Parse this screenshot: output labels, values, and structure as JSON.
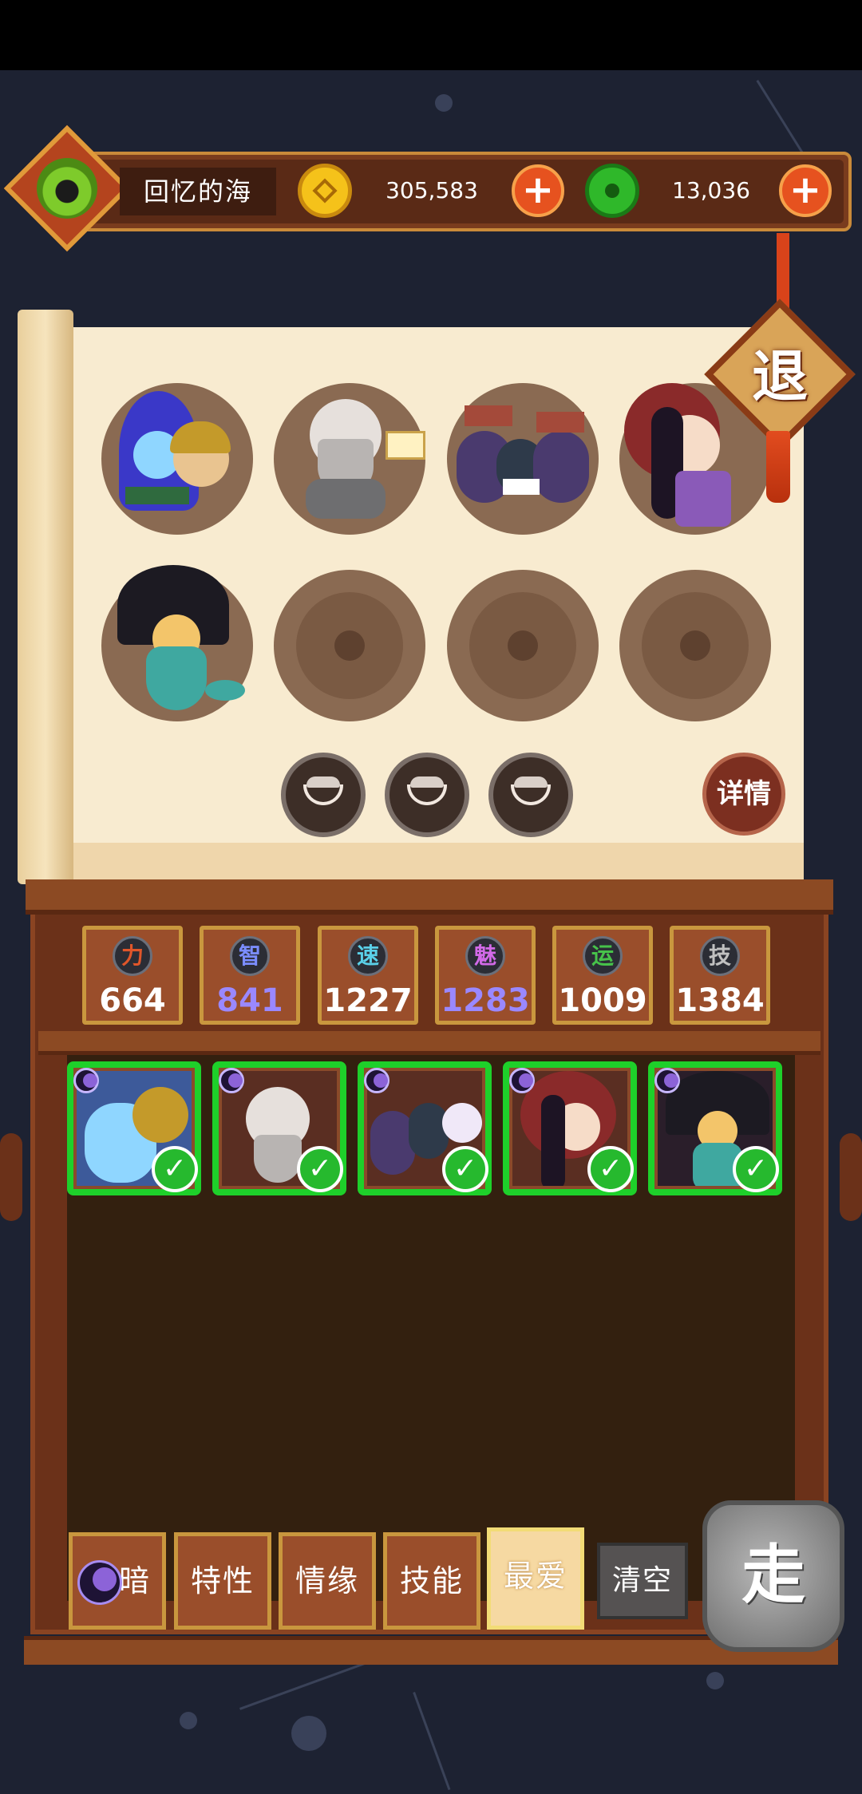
{
  "header": {
    "map_name": "回忆的海",
    "coins": "305,583",
    "jade": "13,036",
    "coin_icon": "copper-coin-icon",
    "jade_icon": "jade-disc-icon",
    "plus_label": "+"
  },
  "retreat_label": "退",
  "team_slots": [
    {
      "filled": true,
      "character": "blue-flame-scholar"
    },
    {
      "filled": true,
      "character": "old-sage-with-book"
    },
    {
      "filled": true,
      "character": "mahjong-blobs"
    },
    {
      "filled": true,
      "character": "hat-girl"
    },
    {
      "filled": true,
      "character": "fan-fish-lady"
    },
    {
      "filled": false
    },
    {
      "filled": false
    },
    {
      "filled": false
    }
  ],
  "detail_label": "详情",
  "stats": [
    {
      "icon": "力",
      "value": "664",
      "color": "#ffffff",
      "icon_color": "#e0562a"
    },
    {
      "icon": "智",
      "value": "841",
      "color": "#9a88ff",
      "icon_color": "#7b8dff"
    },
    {
      "icon": "速",
      "value": "1227",
      "color": "#ffffff",
      "icon_color": "#5ad0e8"
    },
    {
      "icon": "魅",
      "value": "1283",
      "color": "#9a88ff",
      "icon_color": "#d26ae8"
    },
    {
      "icon": "运",
      "value": "1009",
      "color": "#ffffff",
      "icon_color": "#47c24a"
    },
    {
      "icon": "技",
      "value": "1384",
      "color": "#ffffff",
      "icon_color": "#c0c0c0"
    }
  ],
  "check_mark": "✓",
  "filter_tabs": {
    "dark": "暗",
    "trait": "特性",
    "bond": "情缘",
    "skill": "技能",
    "favorite": "最爱",
    "clear": "清空"
  },
  "go_label": "走"
}
